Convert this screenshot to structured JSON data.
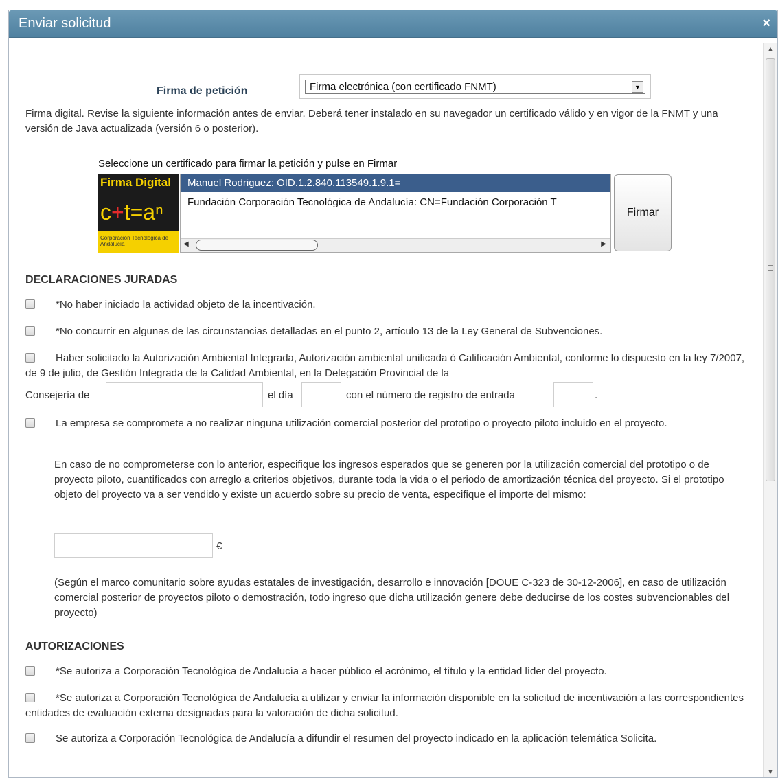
{
  "dialog": {
    "title": "Enviar solicitud",
    "close_glyph": "×"
  },
  "firma": {
    "label": "Firma de petición",
    "selected": "Firma electrónica (con certificado FNMT)"
  },
  "description": "Firma digital. Revise la siguiente información antes de enviar. Deberá tener instalado en su navegador un certificado válido y en vigor de la FNMT y una versión de Java actualizada (versión 6 o posterior).",
  "certificate": {
    "prompt": "Seleccione un certificado para firmar la petición y pulse en Firmar",
    "logo_title": "Firma Digital",
    "logo_a": "c",
    "logo_plus": "+",
    "logo_b": "t=aⁿ",
    "logo_org": "Corporación Tecnológica de Andalucía",
    "items": [
      "Manuel Rodriguez: OID.1.2.840.113549.1.9.1=",
      "Fundación Corporación Tecnológica de Andalucía: CN=Fundación Corporación T"
    ],
    "firmar_label": "Firmar"
  },
  "declaraciones": {
    "heading": "DECLARACIONES JURADAS",
    "item1": "*No haber iniciado la actividad objeto de la incentivación.",
    "item2": "*No concurrir en algunas de las circunstancias detalladas en el punto 2, artículo 13 de la Ley General de Subvenciones.",
    "item3": "Haber solicitado la Autorización Ambiental Integrada, Autorización ambiental unificada ó Calificación Ambiental, conforme lo dispuesto en la ley 7/2007, de 9 de julio, de Gestión Integrada de la Calidad Ambiental, en la Delegación Provincial de la",
    "consejeria_label": "Consejería de",
    "dia_label": "el día",
    "registro_label": "con el número de registro de entrada",
    "period": ".",
    "item4": "La empresa se compromete a no realizar ninguna utilización comercial posterior del prototipo o proyecto piloto incluido en el proyecto.",
    "ingresos_text": "En caso de no comprometerse con lo anterior, especifique los ingresos esperados que se generen por la utilización comercial del prototipo o de proyecto piloto, cuantificados con arreglo a criterios objetivos, durante toda la vida o el periodo de amortización técnica del proyecto. Si el prototipo objeto del proyecto va a ser vendido y existe un acuerdo sobre su precio de venta, especifique el importe del mismo:",
    "currency": "€",
    "marco_text": "(Según el marco comunitario sobre ayudas estatales de investigación, desarrollo e innovación [DOUE C-323 de 30-12-2006], en caso de utilización comercial posterior de proyectos piloto o demostración, todo ingreso que dicha utilización genere debe deducirse de los costes subvencionables del proyecto)"
  },
  "autorizaciones": {
    "heading": "AUTORIZACIONES",
    "item1": "*Se autoriza a Corporación Tecnológica de Andalucía a hacer público el acrónimo, el título y la entidad líder del proyecto.",
    "item2": "*Se autoriza a Corporación Tecnológica de Andalucía a utilizar y enviar la información disponible en la solicitud de incentivación a las correspondientes entidades de evaluación externa designadas para la valoración de dicha solicitud.",
    "item3": "Se autoriza a Corporación Tecnológica de Andalucía a difundir el resumen del proyecto indicado en la aplicación telemática Solicita."
  }
}
